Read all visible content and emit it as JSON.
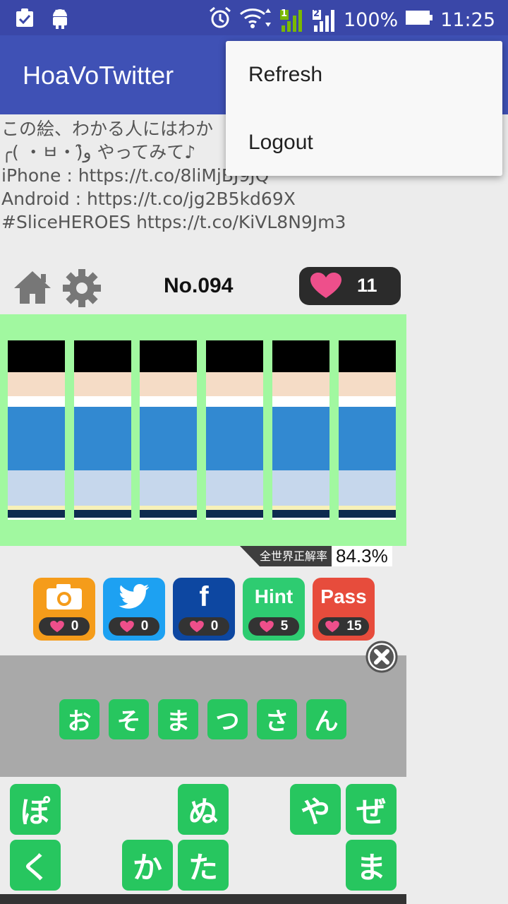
{
  "status_bar": {
    "battery": "100%",
    "time": "11:25",
    "sim1": "1",
    "sim2": "2",
    "icons": [
      "clipboard-check-icon",
      "android-icon",
      "alarm-icon",
      "wifi-icon",
      "signal-sim1-icon",
      "signal-sim2-icon",
      "battery-icon"
    ]
  },
  "app_bar": {
    "title": "HoaVoTwitter"
  },
  "overflow_menu": {
    "items": [
      {
        "label": "Refresh"
      },
      {
        "label": "Logout"
      }
    ]
  },
  "tweet": {
    "lines": [
      "この絵、わかる人にはわか",
      "╭( ・ㅂ・)و̑̑ やってみて♪",
      "iPhone : https://t.co/8liMjBJ9JQ",
      "Android : https://t.co/jg2B5kd69X",
      "#SliceHEROES https://t.co/KiVL8N9Jm3"
    ]
  },
  "game": {
    "puzzle_number": "No.094",
    "hearts": "11",
    "colors": {
      "picture_bg": "#a1f8a0",
      "tile_green": "#27c65f",
      "heart_pink": "#ee4f8b",
      "slice_black": "#000000",
      "slice_skin": "#f5dcc6",
      "slice_white": "#ffffff",
      "slice_blue": "#3289d1",
      "slice_lightblue": "#c6d7ec",
      "slice_yellow": "#f7f1b8",
      "slice_navy": "#0e2b4f"
    },
    "accuracy_label": "全世界正解率",
    "accuracy_value": "84.3%",
    "actions": [
      {
        "name": "camera",
        "label": "",
        "cost": "0",
        "color": "#f59c1a"
      },
      {
        "name": "twitter",
        "label": "",
        "cost": "0",
        "color": "#1da1f2"
      },
      {
        "name": "facebook",
        "label": "f",
        "cost": "0",
        "color": "#0d47a1"
      },
      {
        "name": "hint",
        "label": "Hint",
        "cost": "5",
        "color": "#2ecc71"
      },
      {
        "name": "pass",
        "label": "Pass",
        "cost": "15",
        "color": "#e74c3c"
      }
    ],
    "answer_tiles": [
      "お",
      "そ",
      "ま",
      "つ",
      "さ",
      "ん"
    ],
    "letter_tiles": [
      {
        "char": "ぽ",
        "col": 0,
        "row": 0
      },
      {
        "char": "ぬ",
        "col": 3,
        "row": 0
      },
      {
        "char": "や",
        "col": 5,
        "row": 0
      },
      {
        "char": "ぜ",
        "col": 6,
        "row": 0
      },
      {
        "char": "く",
        "col": 0,
        "row": 1
      },
      {
        "char": "か",
        "col": 2,
        "row": 1
      },
      {
        "char": "た",
        "col": 3,
        "row": 1
      },
      {
        "char": "ま",
        "col": 6,
        "row": 1
      }
    ]
  }
}
